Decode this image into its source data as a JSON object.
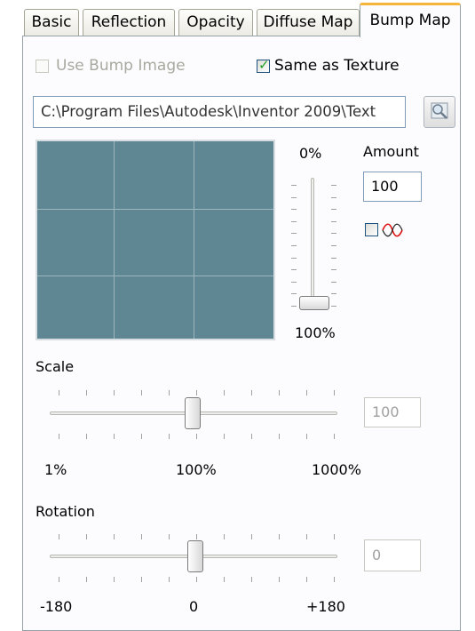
{
  "tabs": [
    {
      "label": "Basic",
      "active": false
    },
    {
      "label": "Reflection",
      "active": false
    },
    {
      "label": "Opacity",
      "active": false
    },
    {
      "label": "Diffuse Map",
      "active": false
    },
    {
      "label": "Bump Map",
      "active": true
    }
  ],
  "bump": {
    "use_bump_image": {
      "label": "Use Bump Image",
      "checked": false,
      "enabled": false
    },
    "same_as_texture": {
      "label": "Same as Texture",
      "checked": true,
      "enabled": true
    },
    "path_value": "C:\\Program Files\\Autodesk\\Inventor 2009\\Text",
    "browse_icon": "magnifier-icon"
  },
  "amount": {
    "label": "Amount",
    "value": "100",
    "slider_top_label": "0%",
    "slider_bottom_label": "100%",
    "slider_value_percent": 100,
    "invert": {
      "checked": false,
      "icon": "wave-invert-icon"
    }
  },
  "scale": {
    "label": "Scale",
    "value": "100",
    "min_label": "1%",
    "mid_label": "100%",
    "max_label": "1000%"
  },
  "rotation": {
    "label": "Rotation",
    "value": "0",
    "min_label": "-180",
    "mid_label": "0",
    "max_label": "+180"
  },
  "colors": {
    "preview_fill": "#5e8693",
    "active_tab_accent": "#f7b43a",
    "check_green": "#21a121"
  }
}
